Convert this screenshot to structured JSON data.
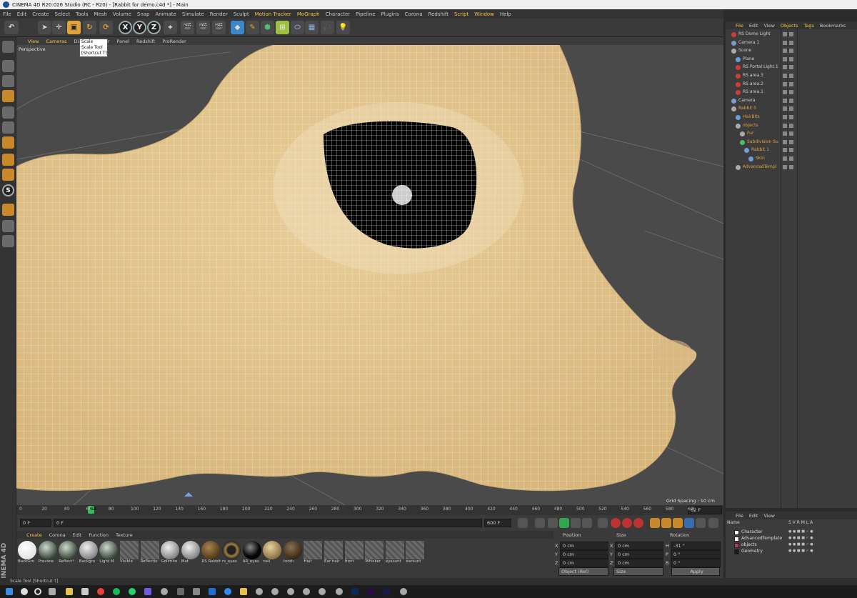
{
  "window": {
    "title": "CINEMA 4D R20.026 Studio (RC - R20) - [Rabbit for demo.c4d *] - Main"
  },
  "menubar": [
    "File",
    "Edit",
    "Create",
    "Select",
    "Tools",
    "Mesh",
    "Volume",
    "Snap",
    "Animate",
    "Simulate",
    "Render",
    "Sculpt",
    "Motion Tracker",
    "MoGraph",
    "Character",
    "Pipeline",
    "Plugins",
    "Corona",
    "Redshift",
    "Script",
    "Window",
    "Help"
  ],
  "menubar_highlight": [
    "Motion Tracker",
    "MoGraph",
    "Script",
    "Window"
  ],
  "toolbar": {
    "axis_x": "X",
    "axis_y": "Y",
    "axis_z": "Z"
  },
  "tooltip": {
    "line1": "Scale",
    "line2": "Scale Tool",
    "line3": "[Shortcut T]"
  },
  "viewport": {
    "menu": [
      "View",
      "Cameras",
      "Display",
      "Filter",
      "Panel",
      "Redshift",
      "ProRender"
    ],
    "label": "Perspective",
    "grid_spacing": "Grid Spacing : 10 cm",
    "model_color": "#e2c48e"
  },
  "timeline": {
    "ticks": [
      "0",
      "20",
      "40",
      "60",
      "80",
      "100",
      "120",
      "140",
      "160",
      "180",
      "200",
      "220",
      "240",
      "260",
      "280",
      "300",
      "320",
      "340",
      "360",
      "380",
      "400",
      "420",
      "440",
      "460",
      "480",
      "500",
      "520",
      "540",
      "560",
      "580",
      "60("
    ],
    "current_frame": "62",
    "end_label": "62 F"
  },
  "transport": {
    "start": "0 F",
    "start2": "0 F",
    "end": "600 F",
    "end2": "600 F"
  },
  "materials": {
    "menu": [
      "Create",
      "Corona",
      "Edit",
      "Function",
      "Texture"
    ],
    "items": [
      {
        "name": "BackGro",
        "kind": "white"
      },
      {
        "name": "Preview",
        "kind": "env"
      },
      {
        "name": "Reflect!",
        "kind": "env"
      },
      {
        "name": "Backgro",
        "kind": "gray"
      },
      {
        "name": "Light M",
        "kind": "env"
      },
      {
        "name": "Visible",
        "kind": "hatch"
      },
      {
        "name": "Reflectio",
        "kind": "hatch"
      },
      {
        "name": "Gdlimite",
        "kind": "gray"
      },
      {
        "name": "Mat",
        "kind": "gray"
      },
      {
        "name": "RS Rabbit",
        "kind": "brown"
      },
      {
        "name": "rs_eyes",
        "kind": "eye"
      },
      {
        "name": "AR_eyes",
        "kind": "black"
      },
      {
        "name": "nail",
        "kind": "tan"
      },
      {
        "name": "tooth",
        "kind": "darkbrown"
      },
      {
        "name": "Hair",
        "kind": "hatch"
      },
      {
        "name": "Ear hair",
        "kind": "hatch"
      },
      {
        "name": "front",
        "kind": "hatch"
      },
      {
        "name": "Whisker",
        "kind": "hatch"
      },
      {
        "name": "eyesunt",
        "kind": "hatch"
      },
      {
        "name": "earsunt",
        "kind": "hatch"
      }
    ]
  },
  "coordinates": {
    "headers": {
      "position": "Position",
      "size": "Size",
      "rotation": "Rotation"
    },
    "rows": [
      {
        "axis": "X",
        "pos": "0 cm",
        "size_axis": "X",
        "size": "0 cm",
        "rot_axis": "H",
        "rot": "-31 °"
      },
      {
        "axis": "Y",
        "pos": "0 cm",
        "size_axis": "Y",
        "size": "0 cm",
        "rot_axis": "P",
        "rot": "0 °"
      },
      {
        "axis": "Z",
        "pos": "0 cm",
        "size_axis": "Z",
        "size": "0 cm",
        "rot_axis": "B",
        "rot": "0 °"
      }
    ],
    "mode": "Object (Rel)",
    "size_mode": "Size",
    "apply": "Apply"
  },
  "object_manager": {
    "menu": [
      "File",
      "Edit",
      "View",
      "Objects",
      "Tags",
      "Bookmarks"
    ],
    "menu_highlight": [
      "File",
      "Objects",
      "Tags"
    ],
    "rows": [
      {
        "name": "RS Dome Light",
        "indent": 0,
        "icon": "#d23b3b",
        "orange": false
      },
      {
        "name": "Camera.1",
        "indent": 0,
        "icon": "#7a9ccf",
        "orange": false
      },
      {
        "name": "Scene",
        "indent": 0,
        "icon": "#aaaaaa",
        "orange": false
      },
      {
        "name": "Plane",
        "indent": 1,
        "icon": "#6da0d8",
        "orange": false
      },
      {
        "name": "RS Portal Light.1",
        "indent": 1,
        "icon": "#d23b3b",
        "orange": false
      },
      {
        "name": "RS area.3",
        "indent": 1,
        "icon": "#d23b3b",
        "orange": false
      },
      {
        "name": "RS area.2",
        "indent": 1,
        "icon": "#d23b3b",
        "orange": false
      },
      {
        "name": "RS area.1",
        "indent": 1,
        "icon": "#d23b3b",
        "orange": false
      },
      {
        "name": "Camera",
        "indent": 0,
        "icon": "#7a9ccf",
        "orange": false
      },
      {
        "name": "Rabbit 0",
        "indent": 0,
        "icon": "#aaaaaa",
        "orange": true
      },
      {
        "name": "HairBits",
        "indent": 1,
        "icon": "#6da0d8",
        "orange": true
      },
      {
        "name": "objects",
        "indent": 1,
        "icon": "#aaaaaa",
        "orange": true
      },
      {
        "name": "Fur",
        "indent": 2,
        "icon": "#aaaaaa",
        "orange": true
      },
      {
        "name": "Subdivision Su",
        "indent": 2,
        "icon": "#4fbf6a",
        "orange": true
      },
      {
        "name": "Rabbit 1",
        "indent": 3,
        "icon": "#6da0d8",
        "orange": true
      },
      {
        "name": "Skin",
        "indent": 4,
        "icon": "#6da0d8",
        "orange": true
      },
      {
        "name": "AdvancedTempl",
        "indent": 1,
        "icon": "#aaaaaa",
        "orange": true
      }
    ]
  },
  "layer_manager": {
    "menu": [
      "File",
      "Edit",
      "View"
    ],
    "header": {
      "name": "Name",
      "cols": "S  V  R  M  L  A"
    },
    "rows": [
      {
        "name": "Character",
        "color": "#ffffff"
      },
      {
        "name": "AdvancedTemplate",
        "color": "#ffffff"
      },
      {
        "name": "objects",
        "color": "#b23a6a"
      },
      {
        "name": "Geometry",
        "color": "#1a1a1a"
      }
    ]
  },
  "statusbar": {
    "text": "Scale Tool [Shortcut T]"
  }
}
